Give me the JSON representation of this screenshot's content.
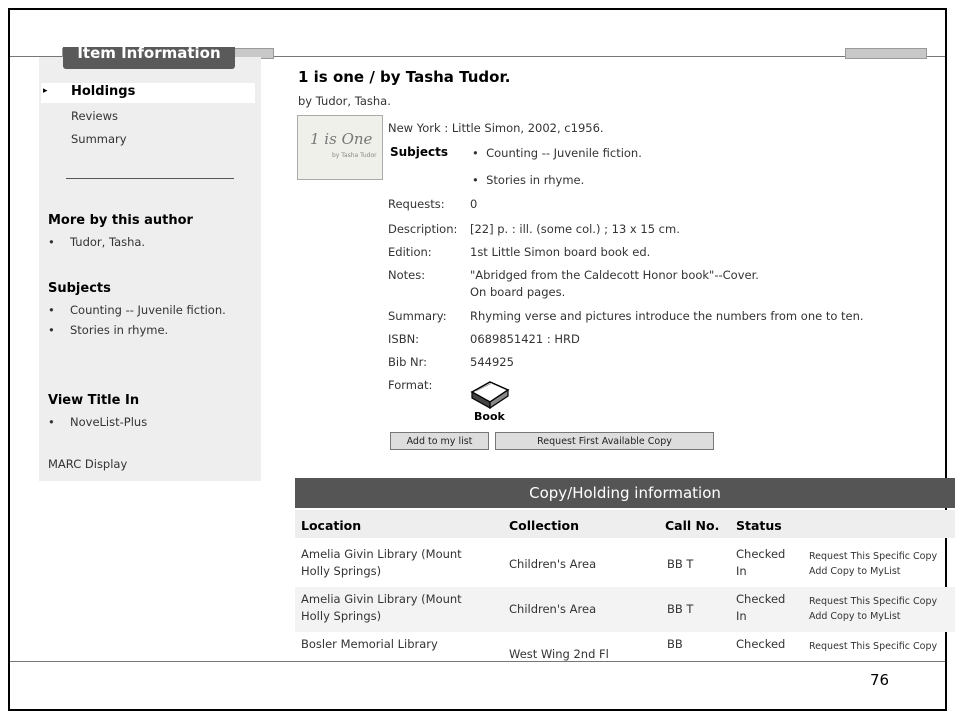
{
  "sidebar": {
    "heading": "Item Information",
    "nav": [
      "Holdings",
      "Reviews",
      "Summary"
    ],
    "more_by_author": {
      "heading": "More by this author",
      "items": [
        "Tudor, Tasha."
      ]
    },
    "subjects": {
      "heading": "Subjects",
      "items": [
        "Counting -- Juvenile fiction.",
        "Stories in rhyme."
      ]
    },
    "view_title_in": {
      "heading": "View Title In",
      "items": [
        "NoveList-Plus"
      ]
    },
    "marc": "MARC Display"
  },
  "record": {
    "title": "1 is one / by Tasha Tudor.",
    "byline": "by Tudor, Tasha.",
    "cover_text": "1 is One",
    "cover_sub": "by Tasha Tudor",
    "publisher": "New York : Little Simon, 2002, c1956.",
    "subjects_label": "Subjects",
    "subjects": [
      "Counting -- Juvenile fiction.",
      "Stories in rhyme."
    ],
    "fields": [
      {
        "label": "Requests:",
        "value": "0"
      },
      {
        "label": "Description:",
        "value": "[22] p. : ill. (some col.) ; 13 x 15 cm."
      },
      {
        "label": "Edition:",
        "value": "1st Little Simon board book ed."
      },
      {
        "label": "Notes:",
        "value": "\"Abridged from the Caldecott Honor book\"--Cover.",
        "value2": "On board pages."
      },
      {
        "label": "Summary:",
        "value": "Rhyming verse and pictures introduce the numbers from one to ten."
      },
      {
        "label": "ISBN:",
        "value": "0689851421 : HRD"
      },
      {
        "label": "Bib Nr:",
        "value": "544925"
      },
      {
        "label": "Format:",
        "value": "Book"
      }
    ],
    "buttons": {
      "add": "Add to my list",
      "request": "Request First Available Copy"
    }
  },
  "holdings": {
    "heading": "Copy/Holding information",
    "columns": [
      "Location",
      "Collection",
      "Call No.",
      "Status"
    ],
    "rows": [
      {
        "location1": "Amelia Givin Library (Mount",
        "location2": "Holly Springs)",
        "collection": "Children's Area",
        "call": "BB T",
        "status1": "Checked",
        "status2": "In",
        "act1": "Request This Specific Copy",
        "act2": "Add Copy to MyList"
      },
      {
        "location1": "Amelia Givin Library (Mount",
        "location2": "Holly Springs)",
        "collection": "Children's Area",
        "call": "BB T",
        "status1": "Checked",
        "status2": "In",
        "act1": "Request This Specific Copy",
        "act2": "Add Copy to MyList"
      },
      {
        "location1": "Bosler Memorial Library",
        "collection": "West Wing 2nd Fl",
        "call": "BB",
        "status1": "Checked",
        "act1": "Request This Specific Copy"
      }
    ]
  },
  "page_number": "76"
}
